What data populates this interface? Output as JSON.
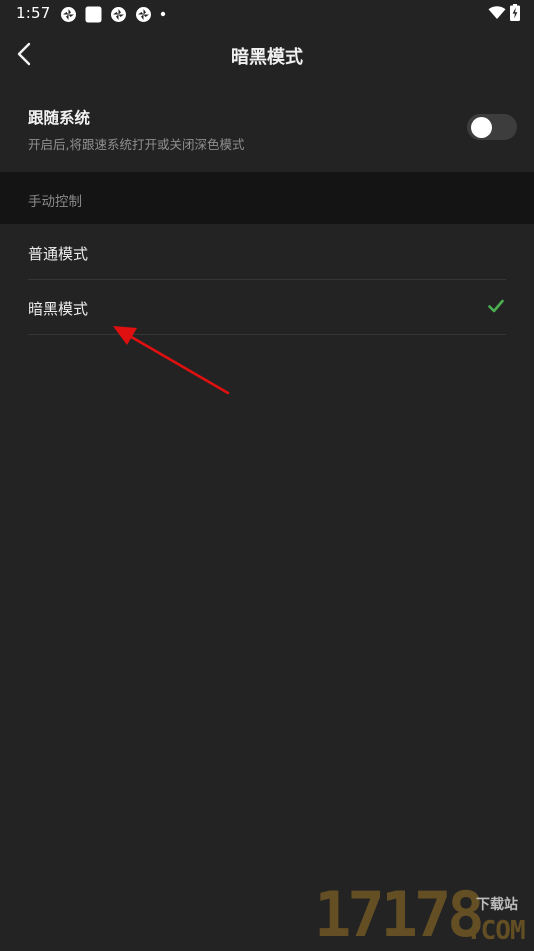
{
  "status_bar": {
    "time": "1:57"
  },
  "header": {
    "title": "暗黑模式"
  },
  "follow_system": {
    "title": "跟随系统",
    "description": "开启后,将跟速系统打开或关闭深色模式",
    "enabled": false
  },
  "manual_control": {
    "section_label": "手动控制",
    "options": [
      {
        "label": "普通模式",
        "selected": false
      },
      {
        "label": "暗黑模式",
        "selected": true
      }
    ]
  },
  "colors": {
    "background": "#232323",
    "section_background": "#141414",
    "check_color": "#4caf50",
    "annotation_arrow": "#e01010"
  },
  "watermark": {
    "number": "17178",
    "site_label": "下载站",
    "domain": ".COM"
  }
}
